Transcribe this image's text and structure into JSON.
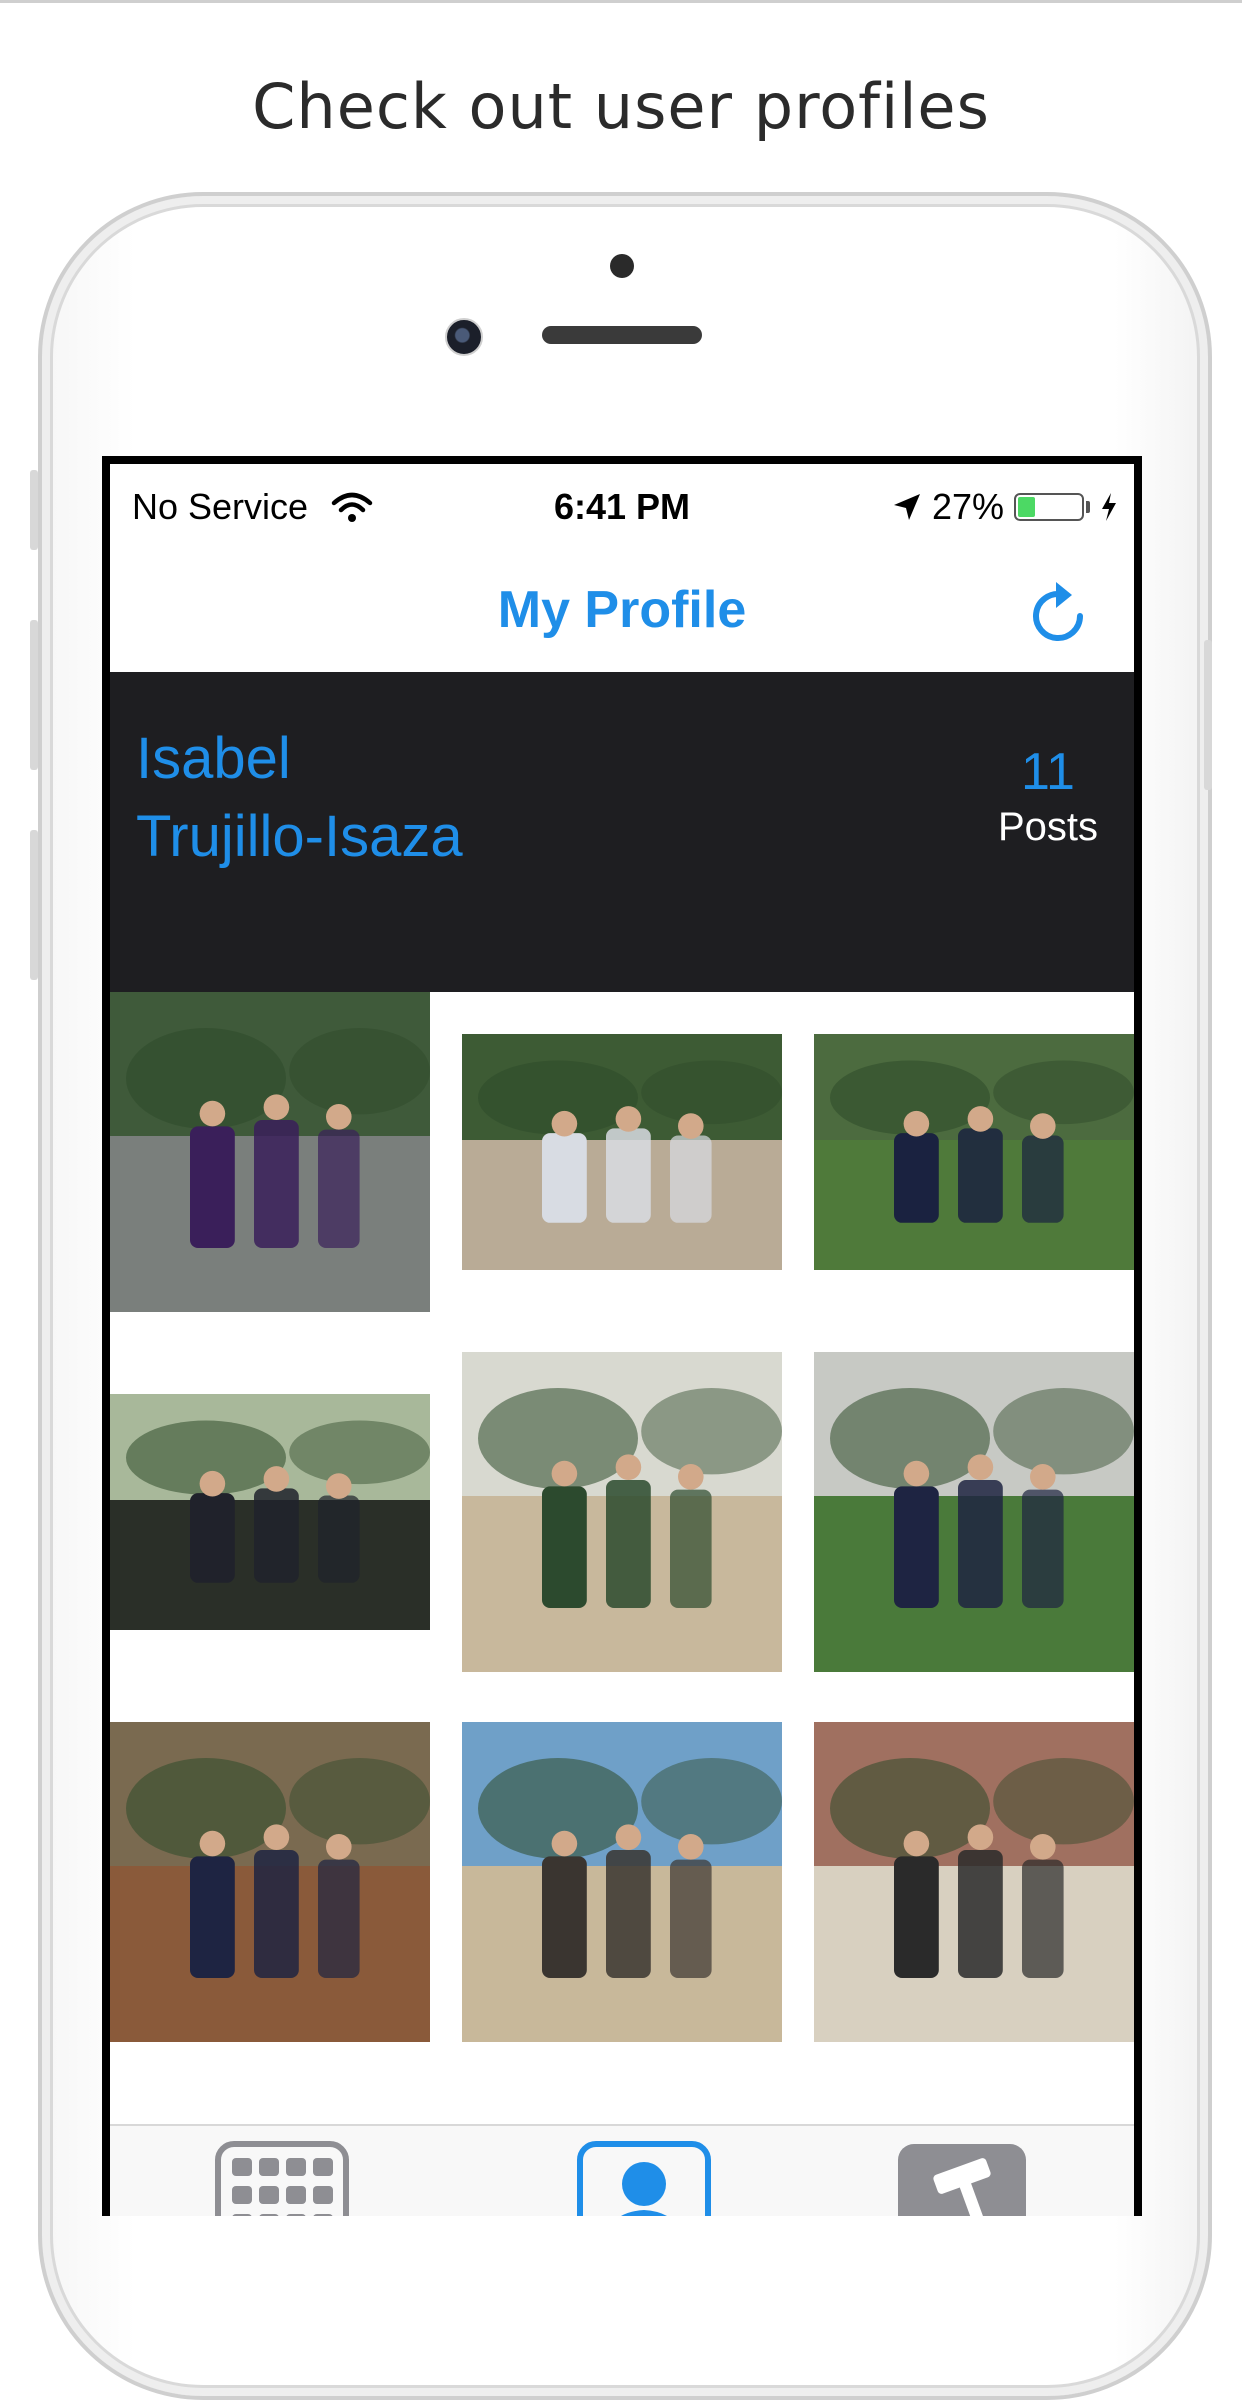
{
  "headline": "Check out user profiles",
  "status": {
    "carrier": "No Service",
    "time": "6:41 PM",
    "battery_percent": "27%",
    "battery_level": 0.27
  },
  "nav": {
    "title": "My Profile",
    "refresh_icon": "refresh-icon"
  },
  "profile": {
    "first_name": "Isabel",
    "last_name": "Trujillo-Isaza",
    "post_count": "11",
    "posts_label": "Posts"
  },
  "photos": [
    {
      "scene": "dinner-table",
      "sky": "#3f5a3a",
      "ground": "#7a7f7c",
      "accent": "#3a1f5a"
    },
    {
      "scene": "group-on-bench",
      "sky": "#3d5b34",
      "ground": "#b9ab96",
      "accent": "#d8dce3"
    },
    {
      "scene": "soccer-team",
      "sky": "#4c6b3f",
      "ground": "#4f7a3a",
      "accent": "#1a2240"
    },
    {
      "scene": "family-formal",
      "sky": "#a8b89a",
      "ground": "#2a2f28",
      "accent": "#20222b"
    },
    {
      "scene": "washington-monument",
      "sky": "#d8d9d0",
      "ground": "#c8b89c",
      "accent": "#2c4a2e"
    },
    {
      "scene": "campus-lawn",
      "sky": "#c7c9c4",
      "ground": "#4a7a3a",
      "accent": "#1e2442"
    },
    {
      "scene": "bench-friends",
      "sky": "#7a6a50",
      "ground": "#8a5a3a",
      "accent": "#1e2442"
    },
    {
      "scene": "plaza-stairs",
      "sky": "#6fa0c8",
      "ground": "#c8b89a",
      "accent": "#3a3530"
    },
    {
      "scene": "apartment-facade",
      "sky": "#a07060",
      "ground": "#d8d0c0",
      "accent": "#2a2a2a"
    }
  ],
  "tabs": [
    {
      "name": "feed-grid-icon",
      "active": false,
      "color": "#8e8e93"
    },
    {
      "name": "profile-icon",
      "active": true,
      "color": "#1f8ee8"
    },
    {
      "name": "settings-hammer-icon",
      "active": false,
      "color": "#8e8e93"
    }
  ],
  "colors": {
    "accent": "#1f8ee8",
    "header_bg": "#1e1e21"
  }
}
